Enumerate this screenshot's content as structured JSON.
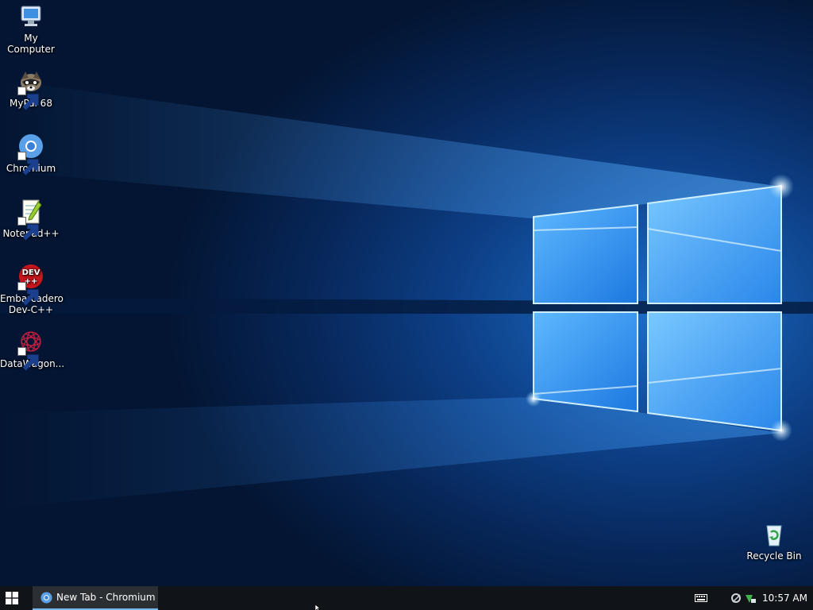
{
  "desktop": {
    "icons": [
      {
        "label": "My Computer",
        "icon": "computer-icon"
      },
      {
        "label": "MyPal 68",
        "icon": "mypal-icon"
      },
      {
        "label": "Chromium",
        "icon": "chromium-icon"
      },
      {
        "label": "Notepad++",
        "icon": "notepad-plus-plus-icon"
      },
      {
        "label": "Embarcadero Dev-C++",
        "icon": "dev-cpp-icon"
      },
      {
        "label": "DataWagon...",
        "icon": "datawagon-icon"
      },
      {
        "label": "Recycle Bin",
        "icon": "recycle-bin-icon"
      }
    ],
    "devcpp_badge_top": "DEV",
    "devcpp_badge_bottom": "++"
  },
  "taskbar": {
    "start_icon": "windows-logo-icon",
    "active_app_title": "New Tab - Chromium",
    "clock_time": "10:57 AM"
  },
  "colors": {
    "taskbar_bg": "#101317",
    "active_app_bg": "#2b2f34",
    "active_app_underline": "#76b9ed",
    "wallpaper_light": "#5cc2ff"
  }
}
